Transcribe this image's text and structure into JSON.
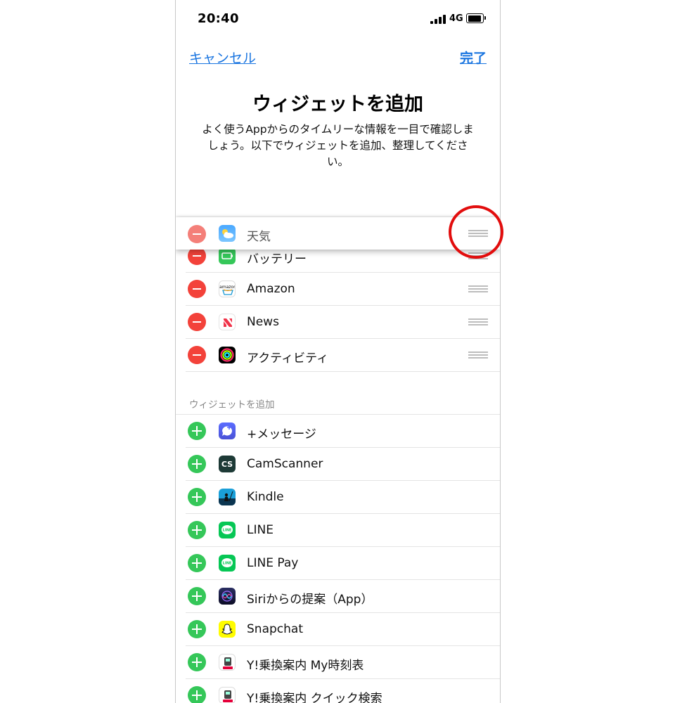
{
  "status_bar": {
    "time": "20:40",
    "network": "4G"
  },
  "nav": {
    "cancel_label": "キャンセル",
    "done_label": "完了"
  },
  "header": {
    "title": "ウィジェットを追加",
    "description": "よく使うAppからのタイムリーな情報を一目で確認しましょう。以下でウィジェットを追加、整理してください。"
  },
  "dragged_item": {
    "label": "天気",
    "icon": "weather-icon"
  },
  "active_widgets": [
    {
      "label": "バッテリー",
      "icon": "battery-app-icon"
    },
    {
      "label": "Amazon",
      "icon": "amazon-icon"
    },
    {
      "label": "News",
      "icon": "news-icon"
    },
    {
      "label": "アクティビティ",
      "icon": "activity-icon"
    }
  ],
  "available_section": {
    "header": "ウィジェットを追加"
  },
  "available_widgets": [
    {
      "label": "+メッセージ",
      "icon": "plus-message-icon"
    },
    {
      "label": "CamScanner",
      "icon": "camscanner-icon"
    },
    {
      "label": "Kindle",
      "icon": "kindle-icon"
    },
    {
      "label": "LINE",
      "icon": "line-icon"
    },
    {
      "label": "LINE Pay",
      "icon": "line-pay-icon"
    },
    {
      "label": "Siriからの提案（App）",
      "icon": "siri-icon"
    },
    {
      "label": "Snapchat",
      "icon": "snapchat-icon"
    },
    {
      "label": "Y!乗換案内 My時刻表",
      "icon": "yahoo-transit-icon"
    },
    {
      "label": "Y!乗換案内 クイック検索",
      "icon": "yahoo-transit-icon"
    }
  ],
  "icon_text": {
    "cs": "CS",
    "line": "LINE",
    "amazon": "amazon"
  },
  "colors": {
    "accent": "#1a75e0",
    "remove": "#f3423a",
    "add": "#35c759",
    "highlight": "#e20d0d"
  }
}
